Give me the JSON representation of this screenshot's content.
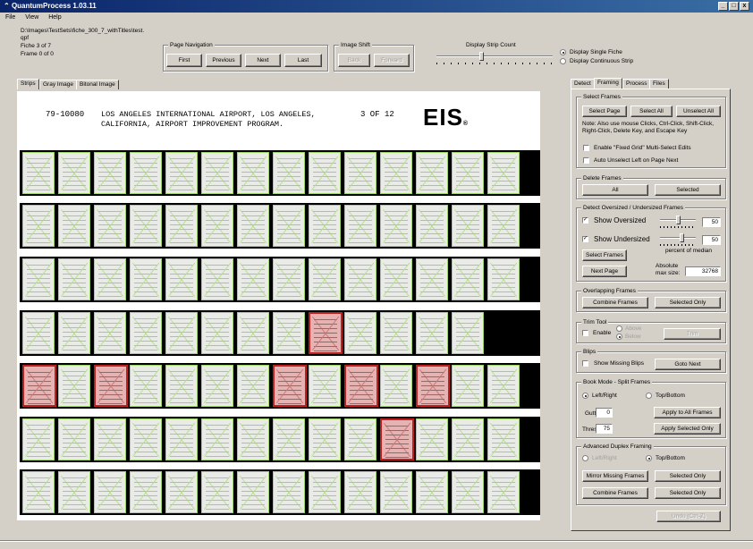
{
  "window": {
    "title": "QuantumProcess 1.03.11",
    "min": "_",
    "max": "□",
    "close": "x"
  },
  "menu": [
    "File",
    "View",
    "Help"
  ],
  "file_info": {
    "path_line1": "D:\\Images\\TestSets\\fiche_300_7_withTitles\\test.",
    "path_line2": "qpf",
    "fiche": "Fiche 3 of 7",
    "frame": "Frame 0 of 0"
  },
  "page_nav": {
    "label": "Page Navigation",
    "first": "First",
    "previous": "Previous",
    "next": "Next",
    "last": "Last"
  },
  "image_shift": {
    "label": "Image Shift",
    "back": "Back",
    "forward": "Forward"
  },
  "strip_count": {
    "label": "Display Strip Count",
    "level": 0.38
  },
  "display_mode": {
    "single": "Display Single Fiche",
    "continuous": "Display Continuous Strip",
    "selected": "single"
  },
  "left_tabs": [
    "Strips",
    "Gray Image",
    "Bitonal Image"
  ],
  "right_tabs": [
    "Detect",
    "Framing",
    "Process",
    "Files"
  ],
  "header_strip": {
    "code": "79-10080",
    "line1": "LOS ANGELES INTERNATIONAL AIRPORT, LOS ANGELES,",
    "line2": "CALIFORNIA, AIRPORT IMPROVEMENT PROGRAM.",
    "sheet": "3 OF 12",
    "logo": "EIS",
    "logo_mark": "®"
  },
  "strips": [
    {
      "frames": 14,
      "flagged": []
    },
    {
      "frames": 14,
      "flagged": []
    },
    {
      "frames": 14,
      "flagged": []
    },
    {
      "frames": 13,
      "flagged": [
        8
      ]
    },
    {
      "frames": 14,
      "flagged": [
        0,
        2,
        7,
        9,
        11
      ]
    },
    {
      "frames": 14,
      "flagged": [
        10
      ]
    },
    {
      "frames": 14,
      "flagged": []
    }
  ],
  "select_frames": {
    "label": "Select Frames",
    "select_page": "Select Page",
    "select_all": "Select All",
    "unselect_all": "Unselect All",
    "note": [
      "Note: Also use mouse Clicks, Ctrl-Click, Shift-Click,",
      "Right-Click, Delete Key, and Escape Key"
    ],
    "fixed_grid": "Enable \"Fixed Grid\" Multi-Select Edits",
    "auto_unselect": "Auto Unselect Left on Page Next"
  },
  "delete_frames": {
    "label": "Delete Frames",
    "all": "All",
    "selected": "Selected"
  },
  "detect_size": {
    "label": "Detect Oversized / Undersized Frames",
    "show_oversized": "Show Oversized",
    "oversized_value": "50",
    "oversized_checked": true,
    "show_undersized": "Show Undersized",
    "undersized_value": "50",
    "undersized_checked": true,
    "percent_label": "percent of median",
    "select_frames": "Select Frames",
    "next_page": "Next Page",
    "absolute_label": "Absolute",
    "max_size_label": "max size:",
    "max_size_value": "32768"
  },
  "overlapping": {
    "label": "Overlapping Frames",
    "combine": "Combine Frames",
    "selected_only": "Selected Only"
  },
  "trim": {
    "label": "Trim Tool",
    "enable": "Enable",
    "above": "Above",
    "below": "Below",
    "trim": "Trim"
  },
  "blips": {
    "label": "Blips",
    "show_missing": "Show Missing Blips",
    "goto_next": "Goto Next"
  },
  "book_mode": {
    "label": "Book Mode - Split Frames",
    "left_right": "Left/Right",
    "top_bottom": "Top/Bottom",
    "gutter_label": "Gutter",
    "gutter_value": "0",
    "apply_all": "Apply to All Frames",
    "threshold_label": "Threshold",
    "threshold_value": "75",
    "apply_selected": "Apply Selected Only"
  },
  "duplex": {
    "label": "Advanced Duplex Framing",
    "left_right": "Left/Right",
    "top_bottom": "Top/Bottom",
    "mirror": "Mirror Missing Frames",
    "selected_only_1": "Selected Only",
    "combine": "Combine Frames",
    "selected_only_2": "Selected Only"
  },
  "undo": "Undo (Ctrl-Z)"
}
